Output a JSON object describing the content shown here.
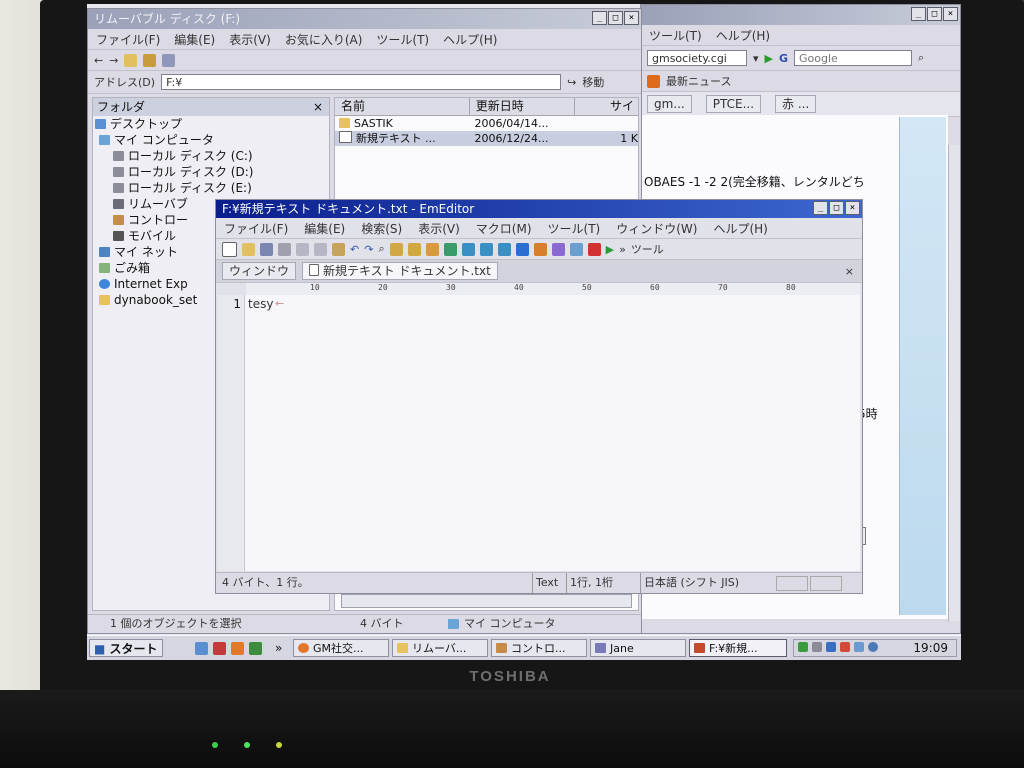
{
  "explorer": {
    "title": "リムーバブル ディスク (F:)",
    "menu": [
      "ファイル(F)",
      "編集(E)",
      "表示(V)",
      "お気に入り(A)",
      "ツール(T)",
      "ヘルプ(H)"
    ],
    "address_label": "アドレス(D)",
    "address_value": "F:¥",
    "go_label": "移動",
    "folder_pane_title": "フォルダ",
    "tree": [
      "デスクトップ",
      "マイ コンピュータ",
      "ローカル ディスク (C:)",
      "ローカル ディスク (D:)",
      "ローカル ディスク (E:)",
      "リムーバブ",
      "コントロー",
      "モバイル",
      "マイ ネット",
      "ごみ箱",
      "Internet Exp",
      "dynabook_set"
    ],
    "columns": [
      "名前",
      "更新日時",
      "サイ"
    ],
    "files": [
      {
        "name": "SASTIK",
        "date": "2006/04/14...",
        "size": ""
      },
      {
        "name": "新規テキスト ...",
        "date": "2006/12/24...",
        "size": "1 K"
      }
    ],
    "status_left": "1 個のオブジェクトを選択",
    "status_mid": "4 バイト",
    "status_right": "マイ コンピュータ"
  },
  "browser": {
    "menu": [
      "ツール(T)",
      "ヘルプ(H)"
    ],
    "url": "gmsociety.cgi",
    "search": "Google",
    "news": "最新ニュース",
    "tabs": [
      "gm...",
      "PTCE...",
      "赤 ..."
    ],
    "content_line": "OBAES -1 -2 2(完全移籍、レンタルどち",
    "content_frag": "5時",
    "btn_frag": "信"
  },
  "emeditor": {
    "title": "F:¥新規テキスト ドキュメント.txt - EmEditor",
    "menu": [
      "ファイル(F)",
      "編集(E)",
      "検索(S)",
      "表示(V)",
      "マクロ(M)",
      "ツール(T)",
      "ウィンドウ(W)",
      "ヘルプ(H)"
    ],
    "toolbar_label": "ツール",
    "tab_window": "ウィンドウ",
    "tab_doc": "新規テキスト ドキュメント.txt",
    "ruler": [
      "10",
      "20",
      "30",
      "40",
      "50",
      "60",
      "70",
      "80"
    ],
    "line_no": "1",
    "text": "tesy",
    "status_left": "4 バイト、1 行。",
    "status_type": "Text",
    "status_pos": "1行, 1桁",
    "status_enc": "日本語 (シフト JIS)"
  },
  "taskbar": {
    "start": "スタート",
    "tasks": [
      "GM社交...",
      "リムーバ...",
      "コントロ...",
      "Jane",
      "F:¥新規..."
    ],
    "clock": "19:09"
  },
  "laptop": {
    "brand": "TOSHIBA"
  }
}
